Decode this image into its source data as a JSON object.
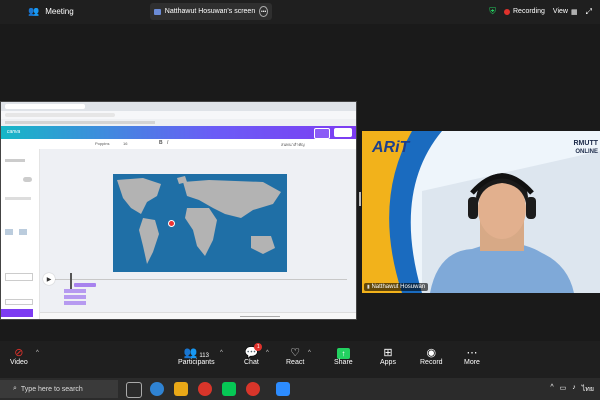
{
  "topbar": {
    "meeting_label": "Meeting",
    "screen_title": "Natthawut Hosuwan's screen",
    "recording_label": "Recording",
    "view_label": "View"
  },
  "shared_screen": {
    "canva": {
      "font_name": "Poppins",
      "font_size": "16",
      "tab_label": "สนทนาสำคัญ"
    }
  },
  "video": {
    "participant_name": "Natthawut Hosuwan",
    "overlay_brand": "ARiT",
    "overlay_org": "RMUTT",
    "overlay_sub": "ONLINE"
  },
  "bottombar": {
    "video_label": "Video",
    "participants_label": "Participants",
    "participants_count": "113",
    "chat_label": "Chat",
    "chat_badge": "1",
    "react_label": "React",
    "share_label": "Share",
    "apps_label": "Apps",
    "record_label": "Record",
    "more_label": "More"
  },
  "taskbar": {
    "search_placeholder": "Type here to search",
    "language": "ไทย"
  },
  "colors": {
    "share_green": "#23d160",
    "record_red": "#e0322c",
    "canva_gradient_start": "#16b7c6",
    "canva_gradient_end": "#7d3cf2"
  }
}
